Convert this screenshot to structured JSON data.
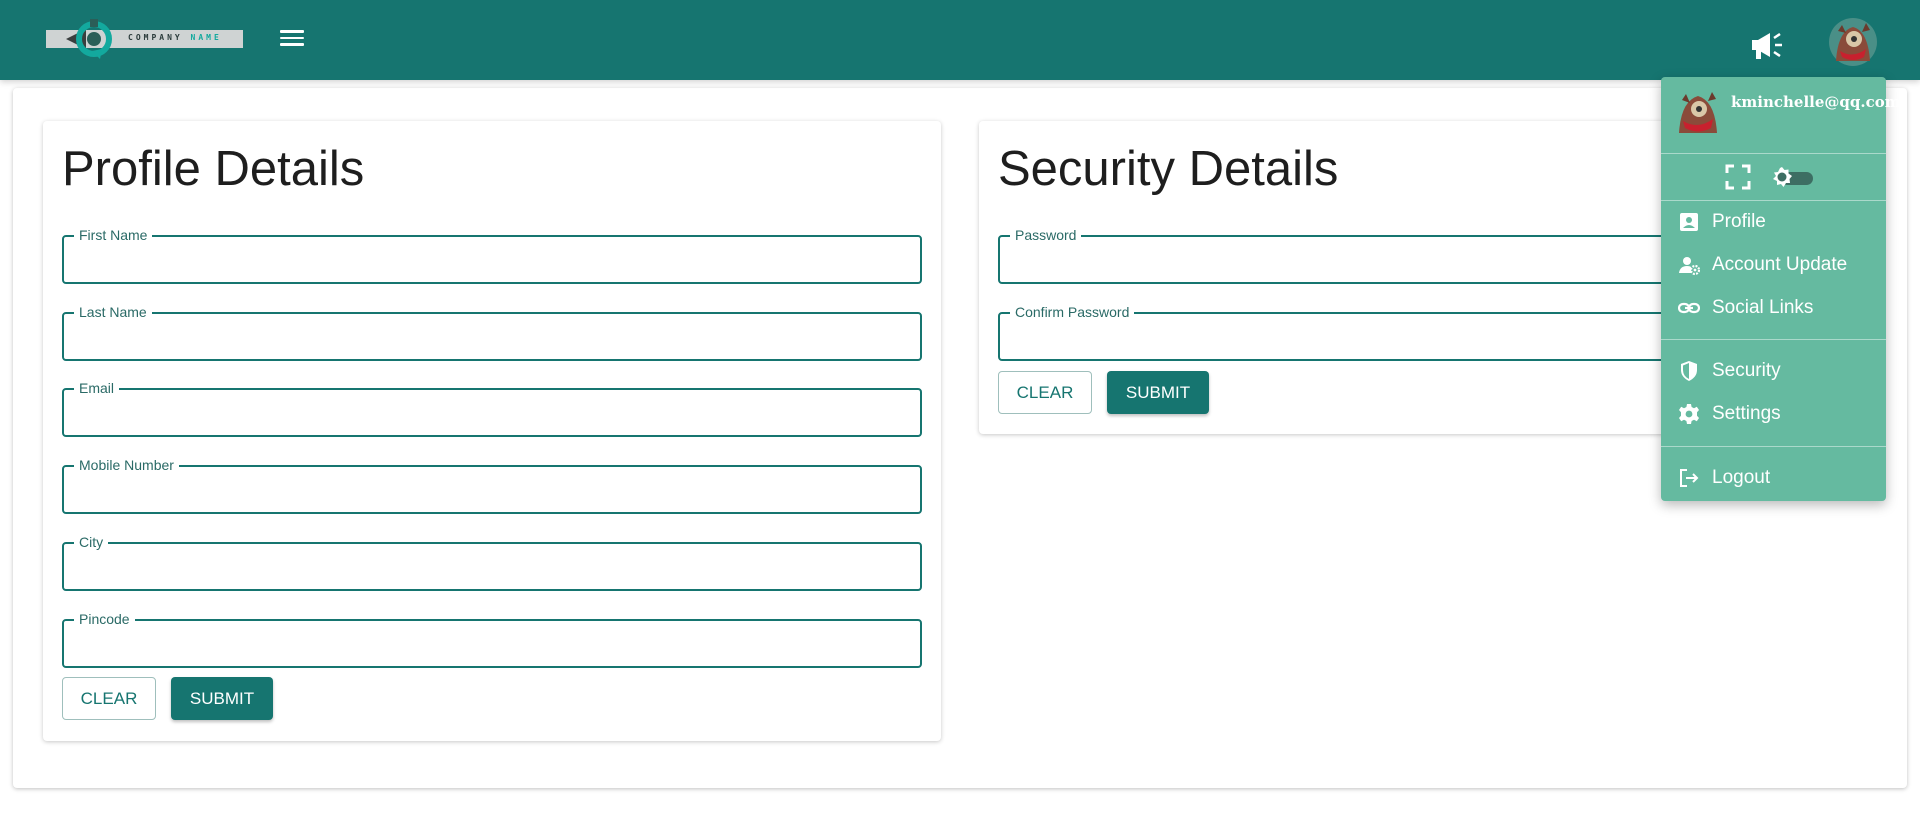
{
  "header": {
    "logo": {
      "word": "COMPANY",
      "word_accent": "NAME"
    },
    "icons": {
      "menu": "hamburger-menu-icon",
      "announce": "megaphone-icon",
      "avatar": "user-avatar"
    }
  },
  "profile": {
    "title": "Profile Details",
    "fields": [
      {
        "label": "First Name",
        "value": ""
      },
      {
        "label": "Last Name",
        "value": ""
      },
      {
        "label": "Email",
        "value": ""
      },
      {
        "label": "Mobile Number",
        "value": ""
      },
      {
        "label": "City",
        "value": ""
      },
      {
        "label": "Pincode",
        "value": ""
      }
    ],
    "clear_label": "CLEAR",
    "submit_label": "SUBMIT"
  },
  "security": {
    "title": "Security Details",
    "fields": [
      {
        "label": "Password",
        "value": ""
      },
      {
        "label": "Confirm Password",
        "value": ""
      }
    ],
    "clear_label": "CLEAR",
    "submit_label": "SUBMIT"
  },
  "dropdown": {
    "email": "kminchelle@qq.com",
    "items": [
      {
        "label": "Profile",
        "icon": "contact-card-icon"
      },
      {
        "label": "Account Update",
        "icon": "person-gear-icon"
      },
      {
        "label": "Social Links",
        "icon": "link-icon"
      },
      {
        "label": "Security",
        "icon": "shield-icon"
      },
      {
        "label": "Settings",
        "icon": "gear-icon"
      },
      {
        "label": "Logout",
        "icon": "logout-icon"
      }
    ],
    "tools": {
      "fullscreen_icon": "fullscreen-icon",
      "theme_icon": "brightness-toggle-icon"
    }
  },
  "colors": {
    "primary": "#167570",
    "menu_bg": "#65baa0",
    "text": "#1e1e1e"
  }
}
